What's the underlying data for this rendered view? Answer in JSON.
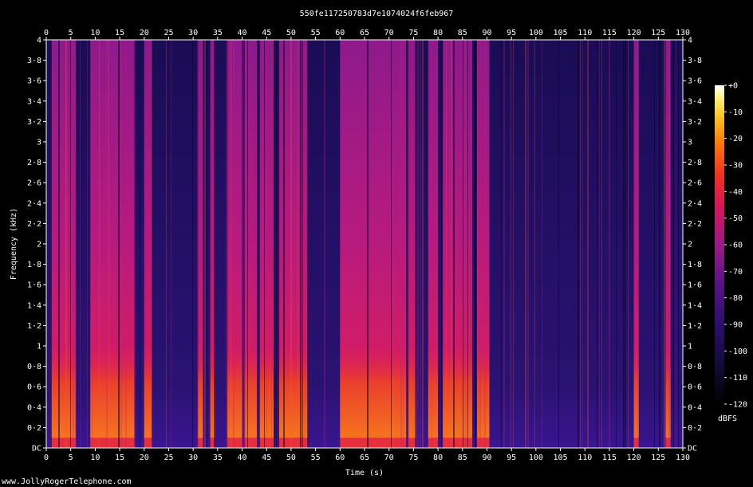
{
  "chart_data": {
    "type": "heatmap",
    "title": "550fe117250783d7e1074024f6feb967",
    "xlabel": "Time (s)",
    "ylabel": "Frequency (kHz)",
    "xlim": [
      0,
      130
    ],
    "ylim": [
      0,
      4
    ],
    "x_ticks": [
      "0",
      "5",
      "10",
      "15",
      "20",
      "25",
      "30",
      "35",
      "40",
      "45",
      "50",
      "55",
      "60",
      "65",
      "70",
      "75",
      "80",
      "85",
      "90",
      "95",
      "100",
      "105",
      "110",
      "115",
      "120",
      "125",
      "130"
    ],
    "y_ticks": [
      "DC",
      "0·2",
      "0·4",
      "0·6",
      "0·8",
      "1",
      "1·2",
      "1·4",
      "1·6",
      "1·8",
      "2",
      "2·2",
      "2·4",
      "2·6",
      "2·8",
      "3",
      "3·2",
      "3·4",
      "3·6",
      "3·8",
      "4"
    ],
    "colorbar": {
      "label": "dBFS",
      "ticks": [
        "+0",
        "-10",
        "-20",
        "-30",
        "-40",
        "-50",
        "-60",
        "-70",
        "-80",
        "-90",
        "-100",
        "-110",
        "-120"
      ],
      "range": [
        -120,
        0
      ]
    },
    "loud_segments_s": [
      [
        1,
        6
      ],
      [
        9,
        18
      ],
      [
        20,
        21.5
      ],
      [
        31,
        32
      ],
      [
        33.5,
        34.5
      ],
      [
        37,
        40
      ],
      [
        40.5,
        43
      ],
      [
        43.5,
        46.5
      ],
      [
        47.5,
        53.5
      ],
      [
        60,
        73.5
      ],
      [
        74,
        75.5
      ],
      [
        78,
        80
      ],
      [
        81,
        87
      ],
      [
        88,
        90.5
      ],
      [
        120,
        121
      ],
      [
        126.5,
        127.5
      ]
    ]
  },
  "footer": {
    "watermark": "www.JollyRogerTelephone.com"
  }
}
